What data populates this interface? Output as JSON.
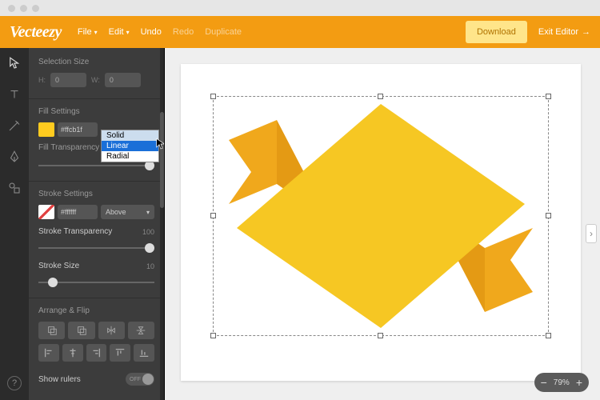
{
  "app": {
    "logo": "Vecteezy"
  },
  "menubar": {
    "file": "File",
    "edit": "Edit",
    "undo": "Undo",
    "redo": "Redo",
    "duplicate": "Duplicate"
  },
  "actions": {
    "download": "Download",
    "exit": "Exit Editor"
  },
  "panel": {
    "selection": {
      "title": "Selection Size",
      "h_label": "H:",
      "h_value": "0",
      "w_label": "W:",
      "w_value": "0"
    },
    "fill": {
      "title": "Fill Settings",
      "hex": "#ffcb1f",
      "options": [
        "Solid",
        "Linear",
        "Radial"
      ],
      "selected": "Solid",
      "hover": "Linear",
      "transparency_label": "Fill Transparency",
      "transparency_pct": 100
    },
    "stroke": {
      "title": "Stroke Settings",
      "hex": "#ffffff",
      "position": "Above",
      "transparency_label": "Stroke Transparency",
      "transparency_value": "100",
      "size_label": "Stroke Size",
      "size_value": "10"
    },
    "arrange": {
      "title": "Arrange & Flip"
    },
    "rulers": {
      "label": "Show rulers",
      "state": "OFF"
    }
  },
  "zoom": {
    "value": "79%"
  },
  "colors": {
    "brand": "#f39c12",
    "shape_main": "#f6c723",
    "shape_dark": "#e49a14",
    "shape_mid": "#f0a81c"
  }
}
